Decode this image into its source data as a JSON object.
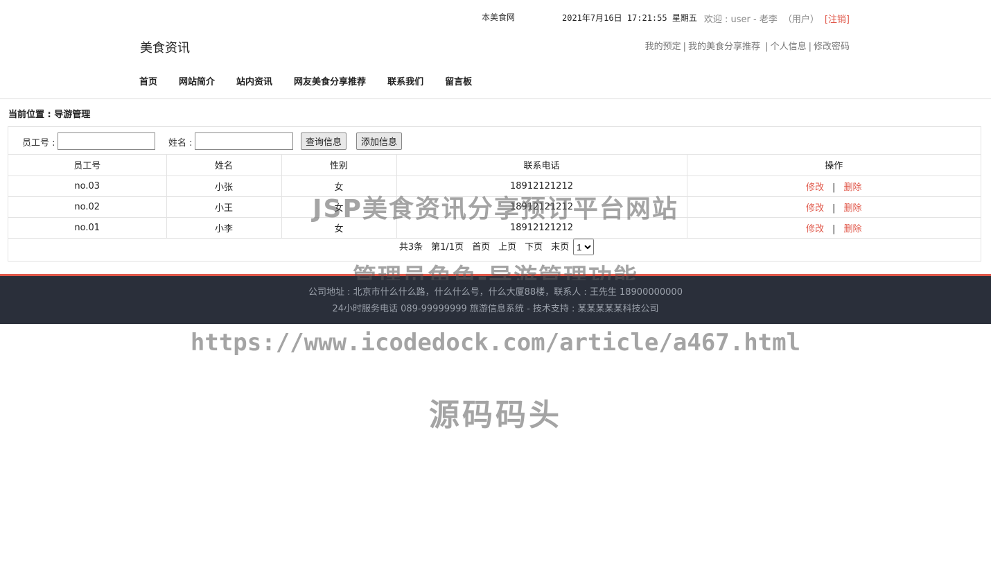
{
  "top": {
    "marquee": "本美食网",
    "datetime": "2021年7月16日 17:21:55 星期五",
    "welcome_prefix": "欢迎 : user - 老李",
    "role": "（用户）",
    "logout": "[注销]"
  },
  "brand": "美食资讯",
  "user_links": [
    "我的预定",
    "我的美食分享推荐",
    "个人信息",
    "修改密码"
  ],
  "nav": [
    "首页",
    "网站简介",
    "站内资讯",
    "网友美食分享推荐",
    "联系我们",
    "留言板"
  ],
  "breadcrumb": "当前位置 : 导游管理",
  "search": {
    "id_label": "员工号 :",
    "id_value": "",
    "name_label": "姓名 :",
    "name_value": "",
    "query_button": "查询信息",
    "add_button": "添加信息"
  },
  "table": {
    "headers": [
      "员工号",
      "姓名",
      "性别",
      "联系电话",
      "操作"
    ],
    "rows": [
      {
        "id": "no.03",
        "name": "小张",
        "gender": "女",
        "phone": "18912121212",
        "edit": "修改",
        "delete": "删除"
      },
      {
        "id": "no.02",
        "name": "小王",
        "gender": "女",
        "phone": "18912121212",
        "edit": "修改",
        "delete": "删除"
      },
      {
        "id": "no.01",
        "name": "小李",
        "gender": "女",
        "phone": "18912121212",
        "edit": "修改",
        "delete": "删除"
      }
    ],
    "op_separator": "|"
  },
  "pager": {
    "total": "共3条",
    "page_info": "第1/1页",
    "first": "首页",
    "prev": "上页",
    "next": "下页",
    "last": "末页",
    "selected_page": "1"
  },
  "footer": {
    "line1": "公司地址 : 北京市什么什么路，什么什么号，什么大厦88楼，联系人 : 王先生 18900000000",
    "line2": "24小时服务电话   089-99999999   旅游信息系统 - 技术支持 : 某某某某某科技公司"
  },
  "watermark": {
    "title": "JSP美食资讯分享预订平台网站",
    "subtitle": "管理员角色-导游管理功能",
    "url": "https://www.icodedock.com/article/a467.html",
    "site": "源码码头"
  },
  "colors": {
    "accent": "#e0584a",
    "footer_bg": "#2a2f3a"
  }
}
